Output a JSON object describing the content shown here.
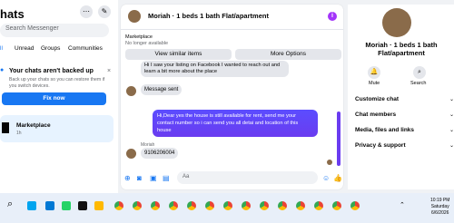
{
  "sidebar": {
    "title": "hats",
    "search_placeholder": "Search Messenger",
    "tabs": [
      "ll",
      "Unread",
      "Groups",
      "Communities"
    ],
    "warning": {
      "title": "Your chats aren't backed up",
      "text": "Back up your chats so you can restore them if you switch devices.",
      "button": "Fix now"
    },
    "conversation": {
      "name": "Marketplace",
      "time": "1h"
    }
  },
  "chat": {
    "title": "Moriah · 1 beds 1 bath Flat/apartment",
    "context_label": "Marketplace",
    "status": "No longer available",
    "actions": [
      "View similar items",
      "More Options"
    ],
    "messages": {
      "incoming_1": "Hi I saw your listing on Facebook I wanted to reach out and learn a bit more about the place",
      "incoming_2": "Message sent",
      "outgoing": "Hi,Dear yes the house is still available for rent, send me your contact number so i can send you all detai and location of this house",
      "sender": "Moriah",
      "incoming_3": "9106206004"
    },
    "compose_placeholder": "Aa"
  },
  "details": {
    "title": "Moriah · 1 beds 1 bath Flat/apartment",
    "buttons": [
      "Mute",
      "Search"
    ],
    "sections": [
      "Customize chat",
      "Chat members",
      "Media, files and links",
      "Privacy & support"
    ]
  },
  "taskbar": {
    "time": "10:19 PM",
    "day": "Saturday",
    "date": "6/6/2026"
  },
  "colors": {
    "accent": "#1877f2",
    "outgoing": "#6a3cf0",
    "info": "#a334fa"
  }
}
